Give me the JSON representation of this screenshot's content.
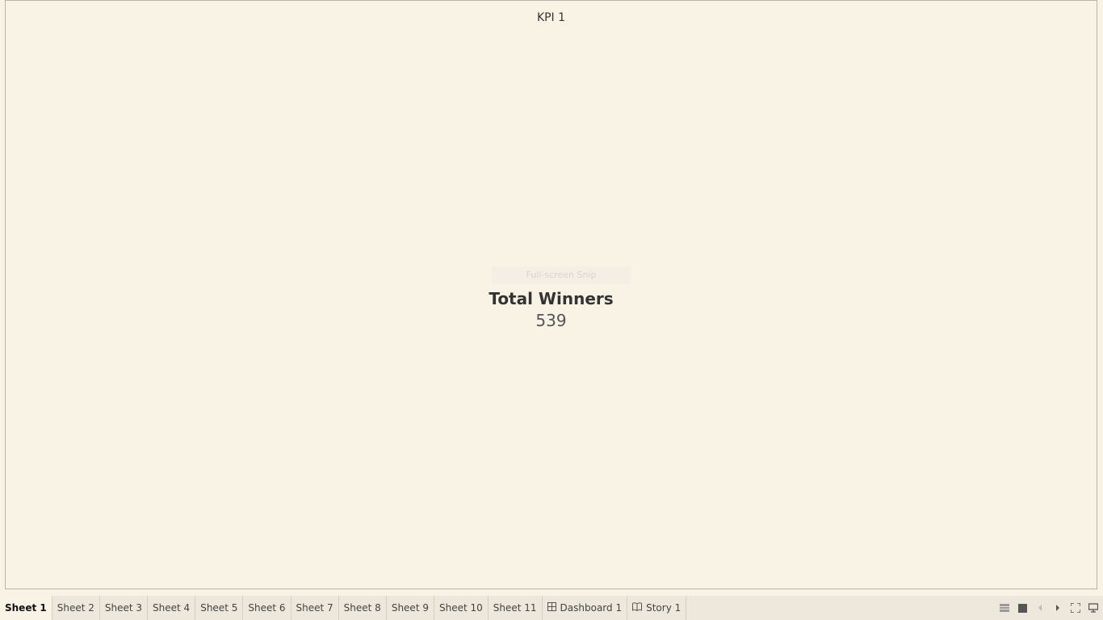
{
  "sheet": {
    "title": "KPI 1",
    "kpi_label": "Total Winners",
    "kpi_value": "539",
    "overlay_text": "Full-screen Snip"
  },
  "tabs": [
    {
      "label": "Sheet 1",
      "icon": null,
      "active": true
    },
    {
      "label": "Sheet 2",
      "icon": null,
      "active": false
    },
    {
      "label": "Sheet 3",
      "icon": null,
      "active": false
    },
    {
      "label": "Sheet 4",
      "icon": null,
      "active": false
    },
    {
      "label": "Sheet 5",
      "icon": null,
      "active": false
    },
    {
      "label": "Sheet 6",
      "icon": null,
      "active": false
    },
    {
      "label": "Sheet 7",
      "icon": null,
      "active": false
    },
    {
      "label": "Sheet 8",
      "icon": null,
      "active": false
    },
    {
      "label": "Sheet 9",
      "icon": null,
      "active": false
    },
    {
      "label": "Sheet 10",
      "icon": null,
      "active": false
    },
    {
      "label": "Sheet 11",
      "icon": null,
      "active": false
    },
    {
      "label": "Dashboard 1",
      "icon": "dashboard-grid-icon",
      "active": false
    },
    {
      "label": "Story 1",
      "icon": "story-book-icon",
      "active": false
    }
  ],
  "controls": [
    {
      "name": "show-filmstrip-icon"
    },
    {
      "name": "show-tabs-icon"
    },
    {
      "name": "previous-sheet-icon"
    },
    {
      "name": "next-sheet-icon"
    },
    {
      "name": "fullscreen-icon"
    },
    {
      "name": "presentation-mode-icon"
    }
  ],
  "colors": {
    "background": "#f9f3e6",
    "tab_bar": "#ede7dc"
  }
}
